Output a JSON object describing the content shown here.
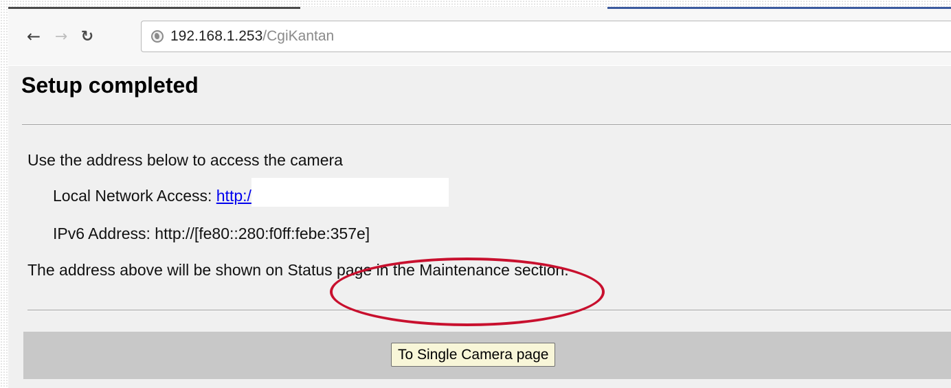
{
  "browser": {
    "url_host": "192.168.1.253",
    "url_path": "/CgiKantan",
    "back_icon": "arrow-left-icon",
    "forward_icon": "arrow-right-icon",
    "reload_icon": "reload-icon",
    "site_icon": "globe-icon"
  },
  "page": {
    "title": "Setup completed",
    "intro": "Use the address below to access the camera",
    "local_access_label": "Local Network Access: ",
    "local_access_link": "http:/",
    "ipv6_text": "IPv6 Address: http://[fe80::280:f0ff:febe:357e]",
    "note": "The address above will be shown on Status page in the Maintenance section.",
    "button_label": "To Single Camera page"
  },
  "colors": {
    "highlight_ring": "#c8102e",
    "link": "#0000ee",
    "button_bg": "#f8f6d8"
  }
}
